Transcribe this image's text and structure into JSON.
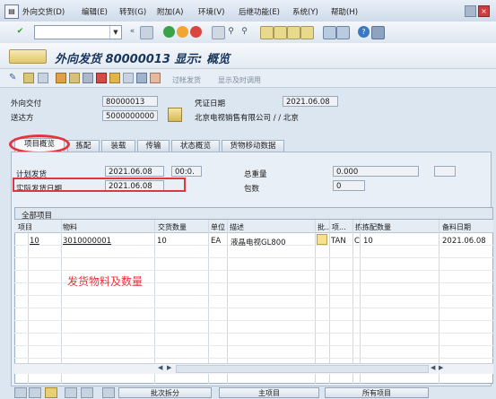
{
  "menu": [
    "外向交货(D)",
    "编辑(E)",
    "转到(G)",
    "附加(A)",
    "环境(V)",
    "后继功能(E)",
    "系统(Y)",
    "帮助(H)"
  ],
  "title": "外向发货 80000013 显示: 概览",
  "app_toolbar": {
    "batch_split": "过帐发货",
    "show_ms": "显示及时调用"
  },
  "header_fields": {
    "outbound_label": "外向交付",
    "outbound_value": "80000013",
    "docdate_label": "凭证日期",
    "docdate_value": "2021.06.08",
    "shipto_label": "送达方",
    "shipto_value": "5000000000",
    "shipto_name": "北京电视销售有限公司 / / 北京"
  },
  "tabs": [
    "项目概览",
    "拣配",
    "装载",
    "传输",
    "状态概览",
    "货物移动数据"
  ],
  "panel": {
    "planned_gi_label": "计划发货",
    "planned_gi_date": "2021.06.08",
    "planned_gi_time": "00:0.",
    "actual_gi_label": "实际发货日期",
    "actual_gi_date": "2021.06.08",
    "total_weight_label": "总重量",
    "total_weight_value": "0.000",
    "packages_label": "包数",
    "packages_value": "0"
  },
  "table": {
    "title": "全部项目",
    "columns": [
      "项目",
      "物料",
      "交货数量",
      "单位",
      "描述",
      "批..",
      "项...",
      "拣",
      "拣配数量",
      "备料日期"
    ],
    "rows": [
      {
        "item": "10",
        "material": "3010000001",
        "qty": "10",
        "unit": "EA",
        "desc": "液晶电视GL800",
        "batch": "",
        "item_cat": "TAN",
        "pick_flag": "C",
        "pick_qty": "10",
        "avail_date": "2021.06.08"
      }
    ]
  },
  "annotation": "发货物料及数量",
  "bottom_buttons": [
    "批次拆分",
    "主项目",
    "所有项目"
  ],
  "colors": {
    "highlight": "#e2363d",
    "title": "#18365b",
    "background": "#dbe6f1"
  }
}
